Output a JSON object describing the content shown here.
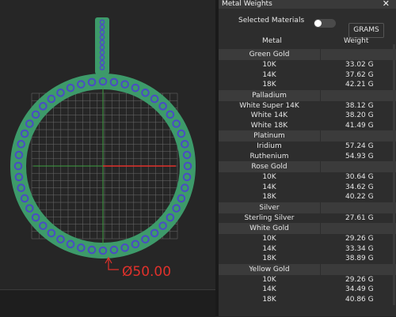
{
  "panel": {
    "title": "Metal Weights",
    "close_glyph": "✕",
    "selected_materials_label": "Selected Materials",
    "toggle_on": false,
    "unit_button": "GRAMS",
    "col_metal": "Metal",
    "col_weight": "Weight",
    "groups": [
      {
        "name": "Green Gold",
        "items": [
          {
            "name": "10K",
            "weight": "33.02 G"
          },
          {
            "name": "14K",
            "weight": "37.62 G"
          },
          {
            "name": "18K",
            "weight": "42.21 G"
          }
        ]
      },
      {
        "name": "Palladium",
        "items": [
          {
            "name": "White Super 14K",
            "weight": "38.12 G"
          },
          {
            "name": "White 14K",
            "weight": "38.20 G"
          },
          {
            "name": "White 18K",
            "weight": "41.49 G"
          }
        ]
      },
      {
        "name": "Platinum",
        "items": [
          {
            "name": "Iridium",
            "weight": "57.24 G"
          },
          {
            "name": "Ruthenium",
            "weight": "54.93 G"
          }
        ]
      },
      {
        "name": "Rose Gold",
        "items": [
          {
            "name": "10K",
            "weight": "30.64 G"
          },
          {
            "name": "14K",
            "weight": "34.62 G"
          },
          {
            "name": "18K",
            "weight": "40.22 G"
          }
        ]
      },
      {
        "name": "Silver",
        "items": [
          {
            "name": "Sterling Silver",
            "weight": "27.61 G"
          }
        ]
      },
      {
        "name": "White Gold",
        "items": [
          {
            "name": "10K",
            "weight": "29.26 G"
          },
          {
            "name": "14K",
            "weight": "33.34 G"
          },
          {
            "name": "18K",
            "weight": "38.89 G"
          }
        ]
      },
      {
        "name": "Yellow Gold",
        "items": [
          {
            "name": "10K",
            "weight": "29.26 G"
          },
          {
            "name": "14K",
            "weight": "34.49 G"
          },
          {
            "name": "18K",
            "weight": "40.86 G"
          }
        ]
      }
    ]
  },
  "viewport": {
    "dimension_label": "Ø50.00",
    "dimension_color": "#e0312b",
    "ring_color": "#3d9a6a",
    "gem_color": "#4a4cc4"
  }
}
